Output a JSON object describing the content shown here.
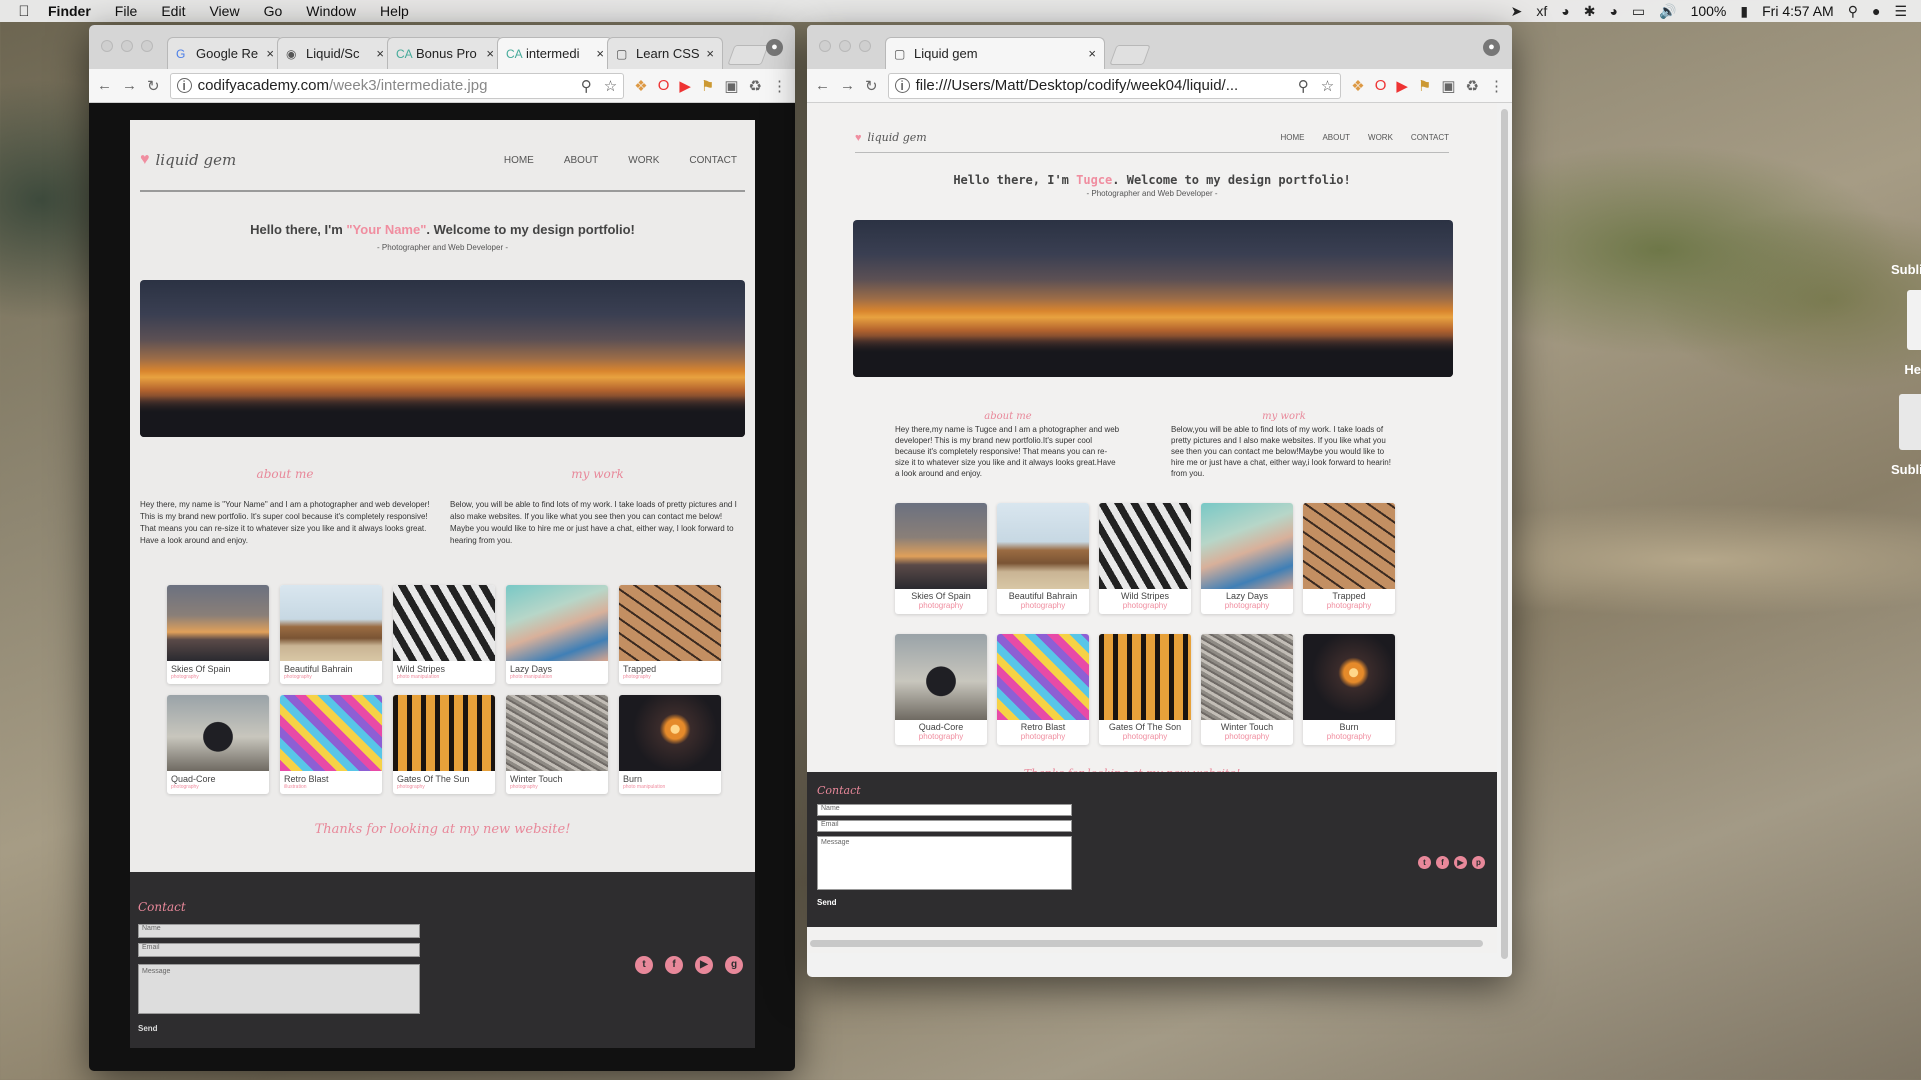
{
  "menubar": {
    "app": "Finder",
    "items": [
      "File",
      "Edit",
      "View",
      "Go",
      "Window",
      "Help"
    ],
    "battery": "100%",
    "time": "Fri 4:57 AM"
  },
  "desktop": {
    "labels": [
      "Subli",
      "He",
      "Subli"
    ]
  },
  "left_browser": {
    "tabs": [
      {
        "label": "Google Re",
        "icon": "google-icon"
      },
      {
        "label": "Liquid/Sc",
        "icon": "github-icon"
      },
      {
        "label": "Bonus Pro",
        "icon": "ca-icon"
      },
      {
        "label": "intermedi",
        "icon": "ca-icon"
      },
      {
        "label": "Learn CSS",
        "icon": "page-icon"
      }
    ],
    "url_host": "codifyacademy.com",
    "url_path": "/week3/intermediate.jpg",
    "site": {
      "logo": "liquid gem",
      "nav": [
        "HOME",
        "ABOUT",
        "WORK",
        "CONTACT"
      ],
      "hello_pre": "Hello there, I'm ",
      "hello_name": "\"Your Name\"",
      "hello_post": ". Welcome to my design portfolio!",
      "sub": "- Photographer and Web Developer -",
      "about_h": "about me",
      "work_h": "my work",
      "about_p": "Hey there, my name is \"Your Name\" and I am a photographer and web developer! This is my brand new portfolio. It's super cool because it's completely responsive! That means you can re-size it to whatever size you like and it always looks great. Have a look around and enjoy.",
      "work_p": "Below, you will be able to find lots of my work. I take loads of pretty pictures and I also make websites. If you like what you see then you can contact me below! Maybe you would like to hire me or just have a chat, either way, I look forward to hearing from you.",
      "cards": [
        {
          "t": "Skies Of Spain",
          "c": "photography"
        },
        {
          "t": "Beautiful Bahrain",
          "c": "photography"
        },
        {
          "t": "Wild Stripes",
          "c": "photo manipulation"
        },
        {
          "t": "Lazy Days",
          "c": "photo manipulation"
        },
        {
          "t": "Trapped",
          "c": "photography"
        },
        {
          "t": "Quad-Core",
          "c": "photography"
        },
        {
          "t": "Retro Blast",
          "c": "illustration"
        },
        {
          "t": "Gates Of The Sun",
          "c": "photography"
        },
        {
          "t": "Winter Touch",
          "c": "photography"
        },
        {
          "t": "Burn",
          "c": "photo manipulation"
        }
      ],
      "thanks": "Thanks for looking at my new website!",
      "contact": "Contact",
      "name_ph": "Name",
      "email_ph": "Email",
      "msg_ph": "Message",
      "send": "Send"
    }
  },
  "right_browser": {
    "tab": "Liquid gem",
    "url": "file:///Users/Matt/Desktop/codify/week04/liquid/...",
    "site": {
      "logo": "liquid gem",
      "nav": [
        "HOME",
        "ABOUT",
        "WORK",
        "CONTACT"
      ],
      "hello_pre": "Hello there, I'm ",
      "hello_name": "Tugce",
      "hello_post": ". Welcome to my design portfolio!",
      "sub": "- Photographer and Web Developer -",
      "about_h": "about me",
      "work_h": "my work",
      "about_p": "Hey there,my name is Tugce and I am a photographer and web developer! This is my brand new portfolio.It's super cool because it's completely responsive! That means you can re-size it to whatever size you like and it always looks great.Have a look around and enjoy.",
      "work_p": "Below,you will be able to find lots of my work. I take loads of pretty pictures and I also make websites. If you like what you see then you can contact me below!Maybe you would like to hire me or just have a chat, either way,i look forward to hearin! from you.",
      "cards": [
        {
          "t": "Skies Of Spain",
          "c": "photography"
        },
        {
          "t": "Beautiful Bahrain",
          "c": "photography"
        },
        {
          "t": "Wild Stripes",
          "c": "photography"
        },
        {
          "t": "Lazy Days",
          "c": "photography"
        },
        {
          "t": "Trapped",
          "c": "photography"
        },
        {
          "t": "Quad-Core",
          "c": "photography"
        },
        {
          "t": "Retro Blast",
          "c": "photography"
        },
        {
          "t": "Gates Of The Son",
          "c": "photography"
        },
        {
          "t": "Winter Touch",
          "c": "photography"
        },
        {
          "t": "Burn",
          "c": "photography"
        }
      ],
      "thanks": "Thanks for looking at my new website!",
      "contact": "Contact",
      "name_ph": "Name",
      "email_ph": "Email",
      "msg_ph": "Message",
      "send": "Send"
    }
  },
  "colors": {
    "accent": "#f08ea0",
    "footer": "#2e2d2f"
  }
}
